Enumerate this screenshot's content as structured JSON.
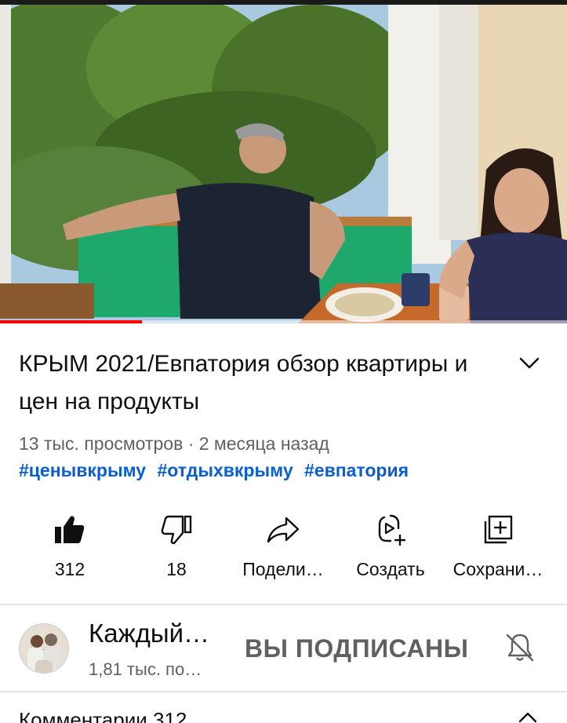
{
  "video": {
    "progress_fraction": 0.25
  },
  "title": "КРЫМ 2021/Евпатория обзор квартиры и цен на продукты",
  "meta": {
    "views": "13 тыс. просмотров",
    "separator": "·",
    "age": "2 месяца назад"
  },
  "hashtags": [
    "#ценывкрыму",
    "#отдыхвкрыму",
    "#евпатория"
  ],
  "actions": {
    "like": {
      "label": "312",
      "icon": "thumb-up-filled-icon"
    },
    "dislike": {
      "label": "18",
      "icon": "thumb-down-outline-icon"
    },
    "share": {
      "label": "Подели…",
      "icon": "share-arrow-icon"
    },
    "create": {
      "label": "Создать",
      "icon": "create-remix-icon"
    },
    "save": {
      "label": "Сохрани…",
      "icon": "playlist-add-icon"
    }
  },
  "channel": {
    "name": "Каждый…",
    "subscribers": "1,81 тыс. по…",
    "subscribe_state": "ВЫ ПОДПИСАНЫ",
    "bell_icon": "notifications-off-icon"
  },
  "comments": {
    "label": "Комментарии",
    "count": "312"
  },
  "colors": {
    "progress": "#ff0000",
    "hashtag": "#065fd4",
    "secondary_text": "#606060"
  }
}
